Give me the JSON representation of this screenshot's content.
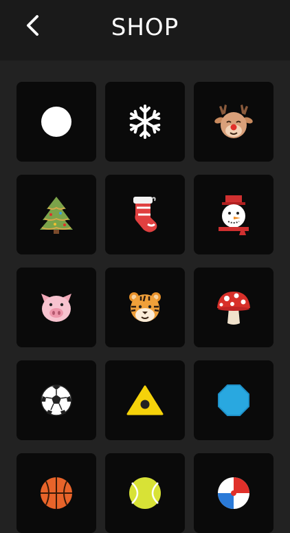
{
  "header": {
    "title": "SHOP"
  },
  "items": [
    {
      "name": "ball-white-icon"
    },
    {
      "name": "snowflake-icon"
    },
    {
      "name": "reindeer-icon"
    },
    {
      "name": "christmas-tree-icon"
    },
    {
      "name": "christmas-stocking-icon"
    },
    {
      "name": "snowman-icon"
    },
    {
      "name": "pig-icon"
    },
    {
      "name": "tiger-icon"
    },
    {
      "name": "mushroom-icon"
    },
    {
      "name": "soccer-ball-icon"
    },
    {
      "name": "yellow-triangle-icon"
    },
    {
      "name": "blue-octagon-icon"
    },
    {
      "name": "basketball-icon"
    },
    {
      "name": "tennis-ball-icon"
    },
    {
      "name": "beach-ball-icon"
    }
  ]
}
